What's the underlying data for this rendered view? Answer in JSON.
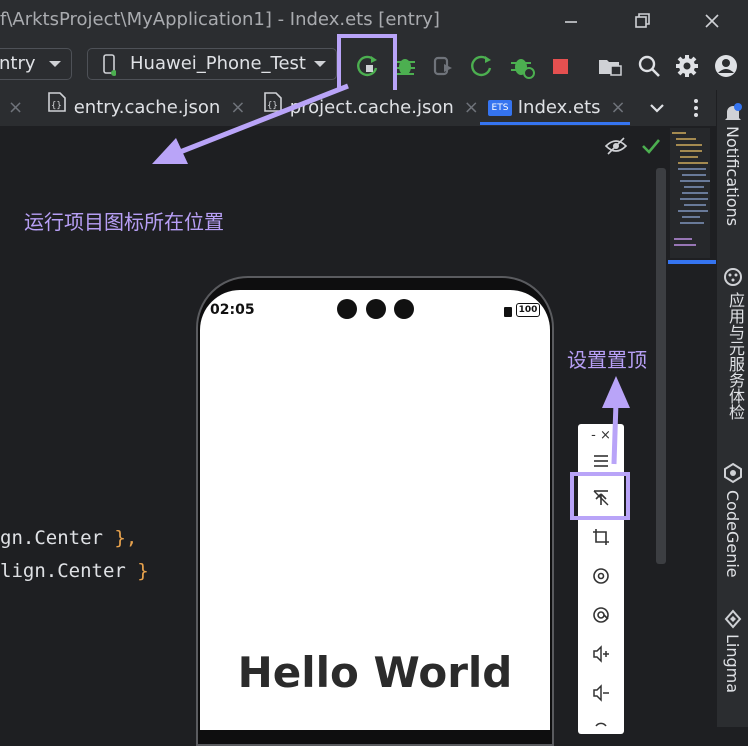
{
  "titlebar": {
    "title": "f\\ArktsProject\\MyApplication1] - Index.ets [entry]",
    "min_icon": "minimize-icon",
    "max_icon": "restore-icon",
    "close_icon": "close-icon"
  },
  "toolbar": {
    "module_select": "ntry",
    "device_select": "Huawei_Phone_Test"
  },
  "tabs": [
    {
      "label": "entry.cache.json",
      "icon": "json-file-icon"
    },
    {
      "label": "project.cache.json",
      "icon": "json-file-icon"
    },
    {
      "label": "Index.ets",
      "icon": "ets-file-icon",
      "icon_text": "ETS"
    }
  ],
  "editor": {
    "line1_a": "gn.Center",
    "line1_b": " },",
    "line2_a": "lign.Center",
    "line2_b": " }"
  },
  "rightbar": {
    "notifications": "Notifications",
    "app_check": "应用与元服务体检",
    "codegenie": "CodeGenie",
    "lingma": "Lingma"
  },
  "phone": {
    "time": "02:05",
    "battery": "100",
    "hello": "Hello World"
  },
  "emulator_bar": {
    "top_controls": "- ×"
  },
  "annotations": {
    "run_location": "运行项目图标所在位置",
    "pin_top": "设置置顶"
  },
  "colors": {
    "accent": "#3574f0",
    "annotation": "#b79ff5",
    "run_green": "#4caf50",
    "stop_red": "#e55050"
  }
}
